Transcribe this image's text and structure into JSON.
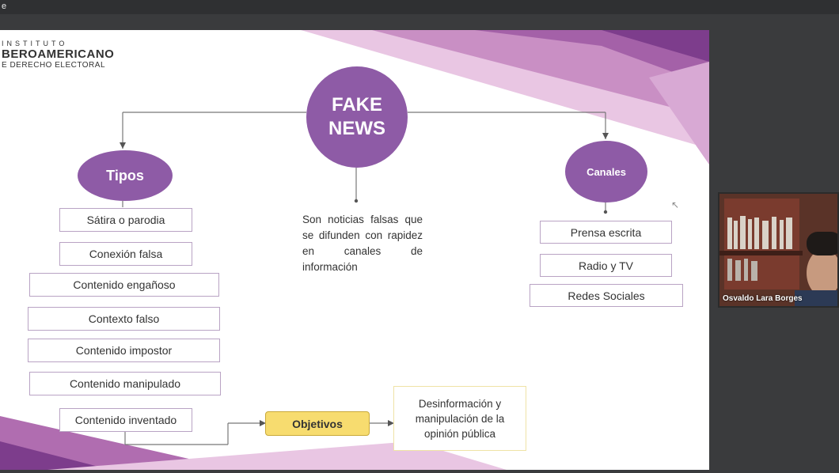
{
  "window": {
    "topbar_glyph": "e"
  },
  "slide": {
    "logo": {
      "line1": "INSTITUTO",
      "line2": "BEROAMERICANO",
      "line3": "E DERECHO ELECTORAL"
    },
    "center": {
      "title": "FAKE\nNEWS",
      "description": "Son noticias falsas que se difunden con rapidez en canales de información"
    },
    "tipos": {
      "title": "Tipos",
      "items": [
        "Sátira o parodia",
        "Conexión falsa",
        "Contenido engañoso",
        "Contexto falso",
        "Contenido impostor",
        "Contenido manipulado",
        "Contenido inventado"
      ]
    },
    "canales": {
      "title": "Canales",
      "items": [
        "Prensa escrita",
        "Radio y TV",
        "Redes Sociales"
      ]
    },
    "objetivos": {
      "label": "Objetivos",
      "result": "Desinformación y\nmanipulación de la\nopinión pública"
    }
  },
  "participant": {
    "name": "Osvaldo Lara Borges"
  },
  "colors": {
    "accent_purple": "#8e5ba6",
    "objetivos_yellow": "#f7dc6f",
    "box_border": "#b9a3c4"
  }
}
